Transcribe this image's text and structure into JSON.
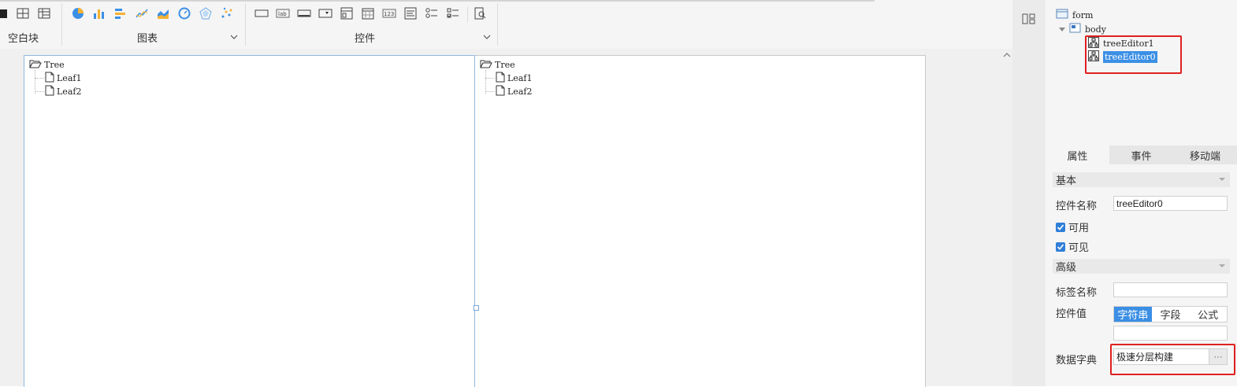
{
  "toolbar": {
    "blank_label": "空白块",
    "chart_label": "图表",
    "widget_label": "控件",
    "chart_icons": [
      "pie-chart-icon",
      "bar-chart-icon",
      "horizontal-bar-icon",
      "line-chart-icon",
      "area-chart-icon",
      "gauge-icon",
      "radar-icon",
      "scatter-icon"
    ],
    "widget_icons": [
      "text-box-icon",
      "label-icon",
      "button-icon",
      "combo-box-icon",
      "multi-frame-icon",
      "date-icon",
      "number-icon",
      "textarea-icon",
      "radio-group-icon",
      "checkbox-group-icon",
      "preview-icon"
    ],
    "widget_number_text": "123",
    "widget_lab_text": "lab"
  },
  "canvas": {
    "left_tree": {
      "root": "Tree",
      "leaves": [
        "Leaf1",
        "Leaf2"
      ]
    },
    "right_tree": {
      "root": "Tree",
      "leaves": [
        "Leaf1",
        "Leaf2"
      ]
    }
  },
  "widget_tree": {
    "root": "form",
    "body": "body",
    "items": [
      "treeEditor1",
      "treeEditor0"
    ],
    "selected": "treeEditor0"
  },
  "tabs": [
    "属性",
    "事件",
    "移动端"
  ],
  "properties": {
    "basic_section": "基本",
    "widget_name_label": "控件名称",
    "widget_name_value": "treeEditor0",
    "enabled_label": "可用",
    "visible_label": "可见",
    "advanced_section": "高级",
    "tag_name_label": "标签名称",
    "tag_name_value": "",
    "widget_value_label": "控件值",
    "value_types": [
      "字符串",
      "字段",
      "公式"
    ],
    "value_type_selected": "字符串",
    "widget_value": "",
    "dictionary_label": "数据字典",
    "dictionary_value": "极速分层构建",
    "more_button": "···"
  },
  "colors": {
    "accent": "#3b8fe5",
    "highlight_border": "#e02020",
    "selection_border": "#8fb8dd"
  }
}
